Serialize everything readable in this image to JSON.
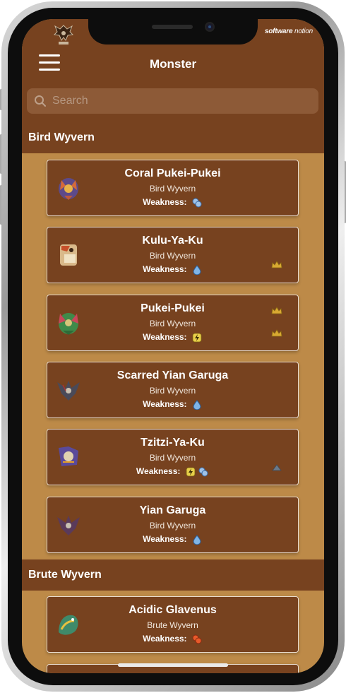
{
  "header": {
    "title": "Monster",
    "brand_part1": "software",
    "brand_part2": "notion"
  },
  "search": {
    "placeholder": "Search"
  },
  "sections": [
    {
      "title": "Bird Wyvern"
    },
    {
      "title": "Brute Wyvern"
    }
  ],
  "weakness_label": "Weakness:",
  "monsters": [
    {
      "name": "Coral Pukei-Pukei",
      "class": "Bird Wyvern",
      "weakness": [
        "thunder"
      ],
      "crowns": []
    },
    {
      "name": "Kulu-Ya-Ku",
      "class": "Bird Wyvern",
      "weakness": [
        "water"
      ],
      "crowns": [
        "gold"
      ]
    },
    {
      "name": "Pukei-Pukei",
      "class": "Bird Wyvern",
      "weakness": [
        "thunder-bolt"
      ],
      "crowns": [
        "gold",
        "gold"
      ]
    },
    {
      "name": "Scarred Yian Garuga",
      "class": "Bird Wyvern",
      "weakness": [
        "water"
      ],
      "crowns": []
    },
    {
      "name": "Tzitzi-Ya-Ku",
      "class": "Bird Wyvern",
      "weakness": [
        "thunder-bolt",
        "thunder"
      ],
      "crowns": [
        "silver"
      ]
    },
    {
      "name": "Yian Garuga",
      "class": "Bird Wyvern",
      "weakness": [
        "water"
      ],
      "crowns": []
    },
    {
      "name": "Acidic Glavenus",
      "class": "Brute Wyvern",
      "weakness": [
        "fire"
      ],
      "crowns": []
    }
  ],
  "colors": {
    "bar": "#77421f",
    "background": "#bd8a48",
    "card": "#77421f",
    "gold_crown": "#d9a932"
  }
}
